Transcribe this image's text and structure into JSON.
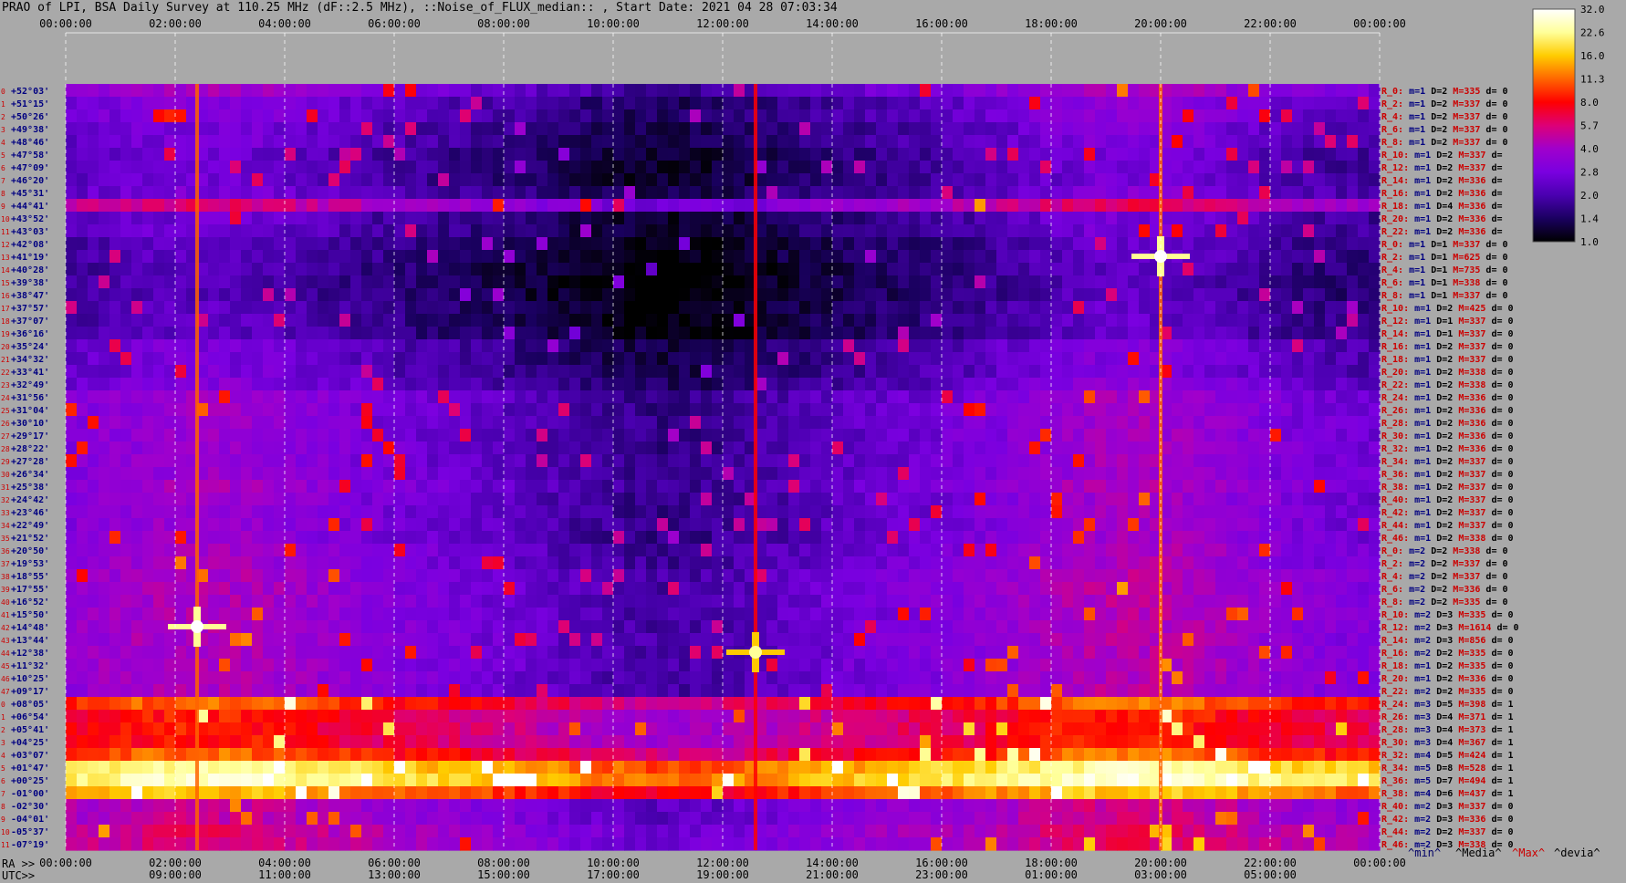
{
  "title": "PRAO of LPI, BSA Daily Survey at 110.25 MHz (dF::2.5 MHz), ::Noise_of_FLUX_median:: , Start Date: 2021 04 28 07:03:34",
  "bottom": {
    "ra_label": "RA >>",
    "utc_label": "UTC>>",
    "legend": [
      {
        "text": "^min^",
        "color": "#000066"
      },
      {
        "text": "^Media^",
        "color": "#000000"
      },
      {
        "text": "^Max^",
        "color": "#cc0000"
      },
      {
        "text": "^devia^",
        "color": "#000000"
      }
    ]
  },
  "chart_data": {
    "type": "heatmap",
    "x_top_ticks": [
      "00:00:00",
      "02:00:00",
      "04:00:00",
      "06:00:00",
      "08:00:00",
      "10:00:00",
      "12:00:00",
      "14:00:00",
      "16:00:00",
      "18:00:00",
      "20:00:00",
      "22:00:00",
      "00:00:00"
    ],
    "x_bottom_ra_ticks": [
      "00:00:00",
      "02:00:00",
      "04:00:00",
      "06:00:00",
      "08:00:00",
      "10:00:00",
      "12:00:00",
      "14:00:00",
      "16:00:00",
      "18:00:00",
      "20:00:00",
      "22:00:00",
      "00:00:00"
    ],
    "x_bottom_utc_ticks": [
      "09:00:00",
      "11:00:00",
      "13:00:00",
      "15:00:00",
      "17:00:00",
      "19:00:00",
      "21:00:00",
      "23:00:00",
      "01:00:00",
      "03:00:00",
      "05:00:00"
    ],
    "y_labels": [
      "+52°03'",
      "+51°15'",
      "+50°26'",
      "+49°38'",
      "+48°46'",
      "+47°58'",
      "+47°09'",
      "+46°20'",
      "+45°31'",
      "+44°41'",
      "+43°52'",
      "+43°03'",
      "+42°08'",
      "+41°19'",
      "+40°28'",
      "+39°38'",
      "+38°47'",
      "+37°57'",
      "+37°07'",
      "+36°16'",
      "+35°24'",
      "+34°32'",
      "+33°41'",
      "+32°49'",
      "+31°56'",
      "+31°04'",
      "+30°10'",
      "+29°17'",
      "+28°22'",
      "+27°28'",
      "+26°34'",
      "+25°38'",
      "+24°42'",
      "+23°46'",
      "+22°49'",
      "+21°52'",
      "+20°50'",
      "+19°53'",
      "+18°55'",
      "+17°55'",
      "+16°52'",
      "+15°50'",
      "+14°48'",
      "+13°44'",
      "+12°38'",
      "+11°32'",
      "+10°25'",
      "+09°17'",
      "+08°05'",
      "+06°54'",
      "+05°41'",
      "+04°25'",
      "+03°07'",
      "+01°47'",
      "+00°25'",
      "-01°00'",
      "-02°30'",
      "-04°01'",
      "-05°37'",
      "-07°19'"
    ],
    "right_labels": [
      {
        "r": "R_0:",
        "m": "m=1",
        "d": "D=2",
        "mx": "M=335",
        "dv": "d= 0"
      },
      {
        "r": "R_2:",
        "m": "m=1",
        "d": "D=2",
        "mx": "M=337",
        "dv": "d= 0"
      },
      {
        "r": "R_4:",
        "m": "m=1",
        "d": "D=2",
        "mx": "M=337",
        "dv": "d= 0"
      },
      {
        "r": "R_6:",
        "m": "m=1",
        "d": "D=2",
        "mx": "M=337",
        "dv": "d= 0"
      },
      {
        "r": "R_8:",
        "m": "m=1",
        "d": "D=2",
        "mx": "M=337",
        "dv": "d= 0"
      },
      {
        "r": "R_10:",
        "m": "m=1",
        "d": "D=2",
        "mx": "M=337",
        "dv": "d="
      },
      {
        "r": "R_12:",
        "m": "m=1",
        "d": "D=2",
        "mx": "M=337",
        "dv": "d="
      },
      {
        "r": "R_14:",
        "m": "m=1",
        "d": "D=2",
        "mx": "M=336",
        "dv": "d="
      },
      {
        "r": "R_16:",
        "m": "m=1",
        "d": "D=2",
        "mx": "M=336",
        "dv": "d="
      },
      {
        "r": "R_18:",
        "m": "m=1",
        "d": "D=4",
        "mx": "M=336",
        "dv": "d="
      },
      {
        "r": "R_20:",
        "m": "m=1",
        "d": "D=2",
        "mx": "M=336",
        "dv": "d="
      },
      {
        "r": "R_22:",
        "m": "m=1",
        "d": "D=2",
        "mx": "M=336",
        "dv": "d="
      },
      {
        "r": "R_0:",
        "m": "m=1",
        "d": "D=1",
        "mx": "M=337",
        "dv": "d= 0"
      },
      {
        "r": "R_2:",
        "m": "m=1",
        "d": "D=1",
        "mx": "M=625",
        "dv": "d= 0"
      },
      {
        "r": "R_4:",
        "m": "m=1",
        "d": "D=1",
        "mx": "M=735",
        "dv": "d= 0"
      },
      {
        "r": "R_6:",
        "m": "m=1",
        "d": "D=1",
        "mx": "M=338",
        "dv": "d= 0"
      },
      {
        "r": "R_8:",
        "m": "m=1",
        "d": "D=1",
        "mx": "M=337",
        "dv": "d= 0"
      },
      {
        "r": "R_10:",
        "m": "m=1",
        "d": "D=2",
        "mx": "M=425",
        "dv": "d= 0"
      },
      {
        "r": "R_12:",
        "m": "m=1",
        "d": "D=1",
        "mx": "M=337",
        "dv": "d= 0"
      },
      {
        "r": "R_14:",
        "m": "m=1",
        "d": "D=1",
        "mx": "M=337",
        "dv": "d= 0"
      },
      {
        "r": "R_16:",
        "m": "m=1",
        "d": "D=2",
        "mx": "M=337",
        "dv": "d= 0"
      },
      {
        "r": "R_18:",
        "m": "m=1",
        "d": "D=2",
        "mx": "M=337",
        "dv": "d= 0"
      },
      {
        "r": "R_20:",
        "m": "m=1",
        "d": "D=2",
        "mx": "M=338",
        "dv": "d= 0"
      },
      {
        "r": "R_22:",
        "m": "m=1",
        "d": "D=2",
        "mx": "M=338",
        "dv": "d= 0"
      },
      {
        "r": "R_24:",
        "m": "m=1",
        "d": "D=2",
        "mx": "M=336",
        "dv": "d= 0"
      },
      {
        "r": "R_26:",
        "m": "m=1",
        "d": "D=2",
        "mx": "M=336",
        "dv": "d= 0"
      },
      {
        "r": "R_28:",
        "m": "m=1",
        "d": "D=2",
        "mx": "M=336",
        "dv": "d= 0"
      },
      {
        "r": "R_30:",
        "m": "m=1",
        "d": "D=2",
        "mx": "M=336",
        "dv": "d= 0"
      },
      {
        "r": "R_32:",
        "m": "m=1",
        "d": "D=2",
        "mx": "M=336",
        "dv": "d= 0"
      },
      {
        "r": "R_34:",
        "m": "m=1",
        "d": "D=2",
        "mx": "M=337",
        "dv": "d= 0"
      },
      {
        "r": "R_36:",
        "m": "m=1",
        "d": "D=2",
        "mx": "M=337",
        "dv": "d= 0"
      },
      {
        "r": "R_38:",
        "m": "m=1",
        "d": "D=2",
        "mx": "M=337",
        "dv": "d= 0"
      },
      {
        "r": "R_40:",
        "m": "m=1",
        "d": "D=2",
        "mx": "M=337",
        "dv": "d= 0"
      },
      {
        "r": "R_42:",
        "m": "m=1",
        "d": "D=2",
        "mx": "M=337",
        "dv": "d= 0"
      },
      {
        "r": "R_44:",
        "m": "m=1",
        "d": "D=2",
        "mx": "M=337",
        "dv": "d= 0"
      },
      {
        "r": "R_46:",
        "m": "m=1",
        "d": "D=2",
        "mx": "M=338",
        "dv": "d= 0"
      },
      {
        "r": "R_0:",
        "m": "m=2",
        "d": "D=2",
        "mx": "M=338",
        "dv": "d= 0"
      },
      {
        "r": "R_2:",
        "m": "m=2",
        "d": "D=2",
        "mx": "M=337",
        "dv": "d= 0"
      },
      {
        "r": "R_4:",
        "m": "m=2",
        "d": "D=2",
        "mx": "M=337",
        "dv": "d= 0"
      },
      {
        "r": "R_6:",
        "m": "m=2",
        "d": "D=2",
        "mx": "M=336",
        "dv": "d= 0"
      },
      {
        "r": "R_8:",
        "m": "m=2",
        "d": "D=2",
        "mx": "M=335",
        "dv": "d= 0"
      },
      {
        "r": "R_10:",
        "m": "m=2",
        "d": "D=3",
        "mx": "M=335",
        "dv": "d= 0"
      },
      {
        "r": "R_12:",
        "m": "m=2",
        "d": "D=3",
        "mx": "M=1614",
        "dv": "d= 0"
      },
      {
        "r": "R_14:",
        "m": "m=2",
        "d": "D=3",
        "mx": "M=856",
        "dv": "d= 0"
      },
      {
        "r": "R_16:",
        "m": "m=2",
        "d": "D=2",
        "mx": "M=335",
        "dv": "d= 0"
      },
      {
        "r": "R_18:",
        "m": "m=1",
        "d": "D=2",
        "mx": "M=335",
        "dv": "d= 0"
      },
      {
        "r": "R_20:",
        "m": "m=1",
        "d": "D=2",
        "mx": "M=336",
        "dv": "d= 0"
      },
      {
        "r": "R_22:",
        "m": "m=2",
        "d": "D=2",
        "mx": "M=335",
        "dv": "d= 0"
      },
      {
        "r": "R_24:",
        "m": "m=3",
        "d": "D=5",
        "mx": "M=398",
        "dv": "d= 1"
      },
      {
        "r": "R_26:",
        "m": "m=3",
        "d": "D=4",
        "mx": "M=371",
        "dv": "d= 1"
      },
      {
        "r": "R_28:",
        "m": "m=3",
        "d": "D=4",
        "mx": "M=373",
        "dv": "d= 1"
      },
      {
        "r": "R_30:",
        "m": "m=3",
        "d": "D=4",
        "mx": "M=367",
        "dv": "d= 1"
      },
      {
        "r": "R_32:",
        "m": "m=4",
        "d": "D=5",
        "mx": "M=424",
        "dv": "d= 1"
      },
      {
        "r": "R_34:",
        "m": "m=5",
        "d": "D=8",
        "mx": "M=528",
        "dv": "d= 1"
      },
      {
        "r": "R_36:",
        "m": "m=5",
        "d": "D=7",
        "mx": "M=494",
        "dv": "d= 1"
      },
      {
        "r": "R_38:",
        "m": "m=4",
        "d": "D=6",
        "mx": "M=437",
        "dv": "d= 1"
      },
      {
        "r": "R_40:",
        "m": "m=2",
        "d": "D=3",
        "mx": "M=337",
        "dv": "d= 0"
      },
      {
        "r": "R_42:",
        "m": "m=2",
        "d": "D=3",
        "mx": "M=336",
        "dv": "d= 0"
      },
      {
        "r": "R_44:",
        "m": "m=2",
        "d": "D=2",
        "mx": "M=337",
        "dv": "d= 0"
      },
      {
        "r": "R_46:",
        "m": "m=2",
        "d": "D=3",
        "mx": "M=338",
        "dv": "d= 0"
      }
    ],
    "colorbar_ticks": [
      "32.0",
      "22.6",
      "16.0",
      "11.3",
      "8.0",
      "5.7",
      "4.0",
      "2.8",
      "2.0",
      "1.4",
      "1.0"
    ],
    "colorbar_colors": [
      "#ffffff",
      "#ffff99",
      "#ffcc00",
      "#ff6600",
      "#ff0000",
      "#dd0077",
      "#a000cc",
      "#7a00e0",
      "#4a00b0",
      "#1a0060",
      "#000000"
    ],
    "row_base_levels": [
      2.8,
      2.2,
      2.2,
      2.0,
      2.0,
      1.8,
      1.8,
      1.8,
      2.0,
      4.0,
      1.8,
      1.8,
      1.6,
      1.6,
      1.5,
      1.5,
      1.5,
      1.6,
      1.6,
      1.6,
      2.0,
      2.0,
      2.0,
      2.2,
      2.6,
      2.6,
      2.6,
      2.6,
      2.6,
      2.6,
      2.6,
      2.8,
      2.6,
      2.6,
      2.6,
      2.6,
      2.8,
      2.8,
      3.0,
      3.0,
      3.0,
      3.0,
      3.0,
      3.0,
      3.0,
      3.0,
      3.0,
      3.0,
      8.0,
      6.0,
      6.0,
      6.0,
      8.0,
      16.0,
      18.0,
      11.0,
      3.5,
      3.5,
      4.0,
      4.0
    ],
    "sources": [
      {
        "ra_hours": 2.4,
        "dec_row": 42,
        "peak": 32.0,
        "label": "bright source near 02:25 RA"
      },
      {
        "ra_hours": 20.0,
        "dec_row": 13,
        "peak": 32.0,
        "label": "bright source near 20:00 RA"
      },
      {
        "ra_hours": 12.6,
        "dec_row": 44,
        "peak": 22.6,
        "label": ""
      }
    ],
    "xlim_hours": [
      0,
      24
    ]
  }
}
